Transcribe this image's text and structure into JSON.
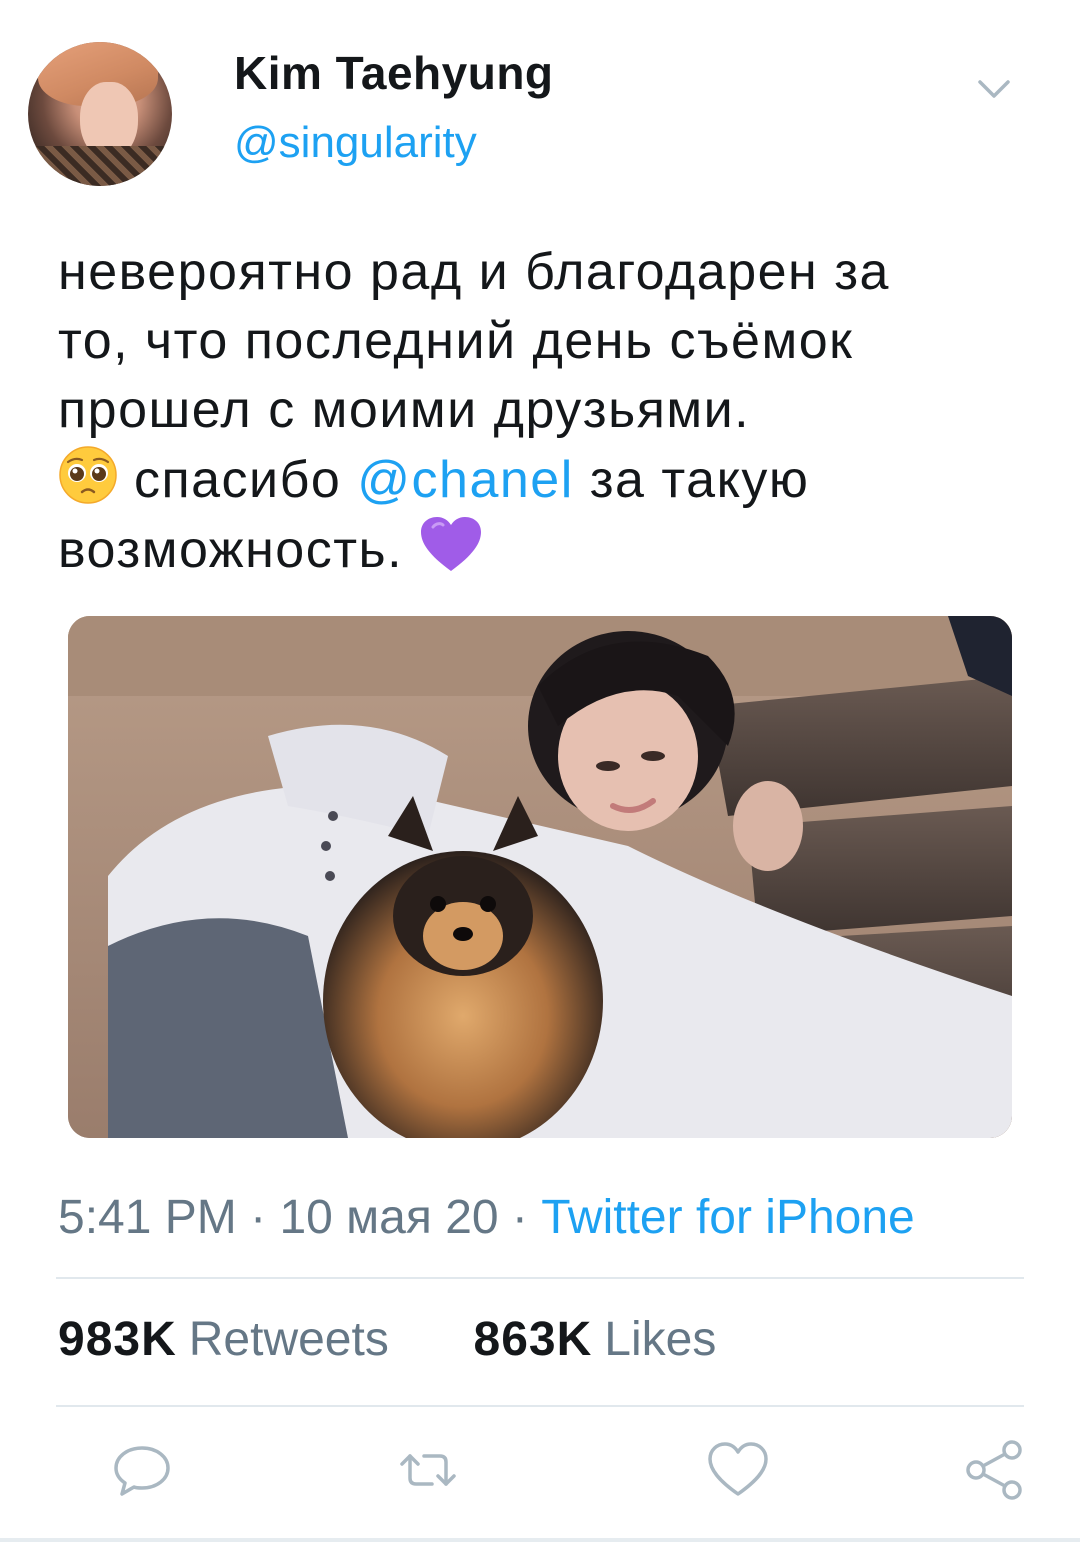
{
  "author": {
    "name": "Kim Taehyung",
    "handle": "@singularity"
  },
  "tweet": {
    "line1": "невероятно рад и благодарен за",
    "line2": "то, что последний день съёмок",
    "line3": "прошел с моими друзьями.",
    "line4_before": "спасибо",
    "mention": "@chanel",
    "line4_after": "за такую",
    "line5": "возможность.",
    "emojis": [
      "pleading-face-emoji",
      "purple-heart-emoji"
    ]
  },
  "meta": {
    "time": "5:41 PM",
    "sep1": "·",
    "date": "10 мая 20",
    "sep2": "·",
    "source": "Twitter for iPhone"
  },
  "stats": {
    "retweets_count": "983K",
    "retweets_label": "Retweets",
    "likes_count": "863K",
    "likes_label": "Likes"
  },
  "actions": [
    "reply-icon",
    "retweet-icon",
    "like-icon",
    "share-icon"
  ],
  "colors": {
    "accent": "#1da1f2",
    "text": "#14171a",
    "secondary": "#657786",
    "divider": "#e1e8ed"
  }
}
